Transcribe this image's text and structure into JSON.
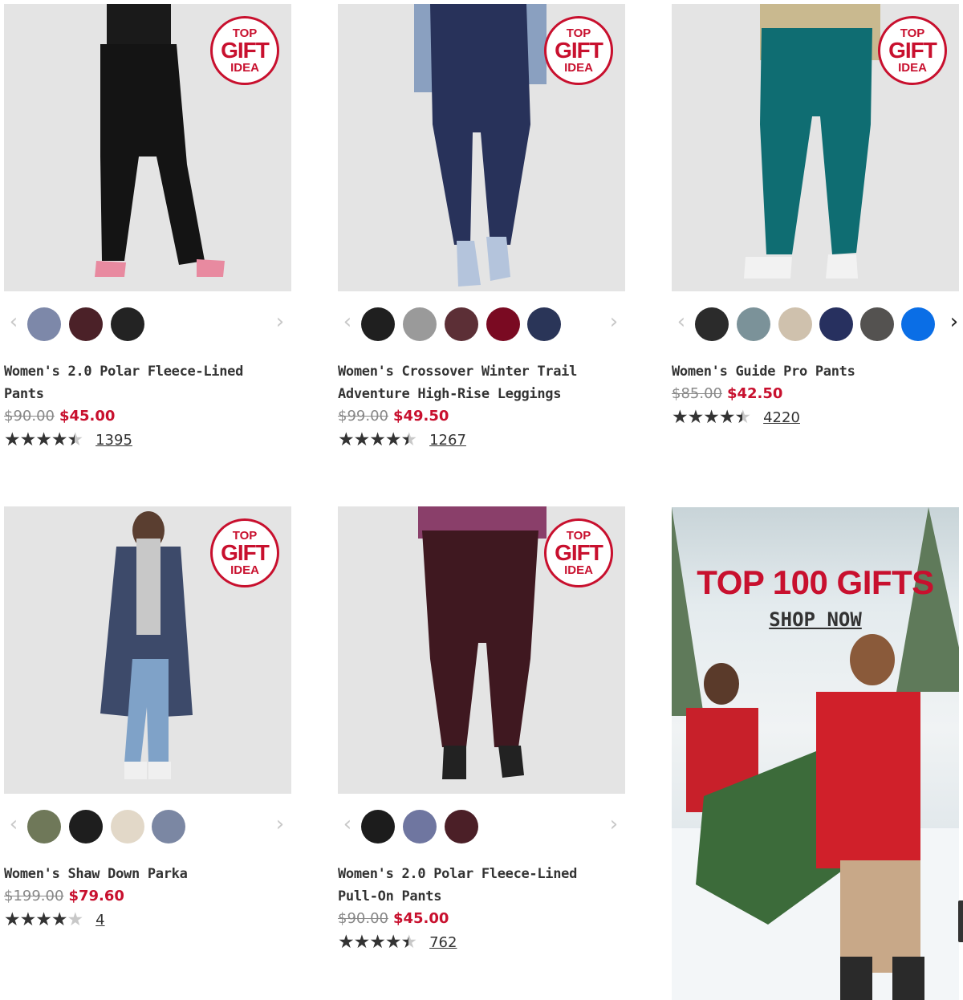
{
  "badge": {
    "line1": "TOP",
    "line2": "GIFT",
    "line3": "IDEA"
  },
  "products": [
    {
      "name": "Women's 2.0 Polar Fleece-Lined Pants",
      "original_price": "$90.00",
      "sale_price": "$45.00",
      "rating": 4.5,
      "review_count": "1395",
      "swatches": [
        "#7d88a9",
        "#4b2128",
        "#232323"
      ]
    },
    {
      "name": "Women's Crossover Winter Trail Adventure High-Rise Leggings",
      "original_price": "$99.00",
      "sale_price": "$49.50",
      "rating": 4.5,
      "review_count": "1267",
      "swatches": [
        "#1f1f1f",
        "#9a9a9a",
        "#5c2f36",
        "#7a0a22",
        "#2a3558"
      ]
    },
    {
      "name": "Women's Guide Pro Pants",
      "original_price": "$85.00",
      "sale_price": "$42.50",
      "rating": 4.5,
      "review_count": "4220",
      "swatches": [
        "#2b2b2b",
        "#7b9299",
        "#cfc1ad",
        "#27305f",
        "#545250",
        "#0a6ee6"
      ]
    },
    {
      "name": "Women's Shaw Down Parka",
      "original_price": "$199.00",
      "sale_price": "$79.60",
      "rating": 4,
      "review_count": "4",
      "swatches": [
        "#6f7859",
        "#1e1e1e",
        "#e2d8c8",
        "#7b87a3"
      ]
    },
    {
      "name": "Women's 2.0 Polar Fleece-Lined Pull-On Pants",
      "original_price": "$90.00",
      "sale_price": "$45.00",
      "rating": 4.5,
      "review_count": "762",
      "swatches": [
        "#1c1c1c",
        "#6f76a0",
        "#4b1f27"
      ]
    }
  ],
  "promo": {
    "title": "TOP 100 GIFTS",
    "link": "SHOP NOW"
  },
  "icons": {
    "prev": "chevron-left-icon",
    "next": "chevron-right-icon",
    "star": "star-icon"
  },
  "colors": {
    "sale": "#c8102e",
    "text": "#333333",
    "image_bg": "#e4e4e4"
  }
}
